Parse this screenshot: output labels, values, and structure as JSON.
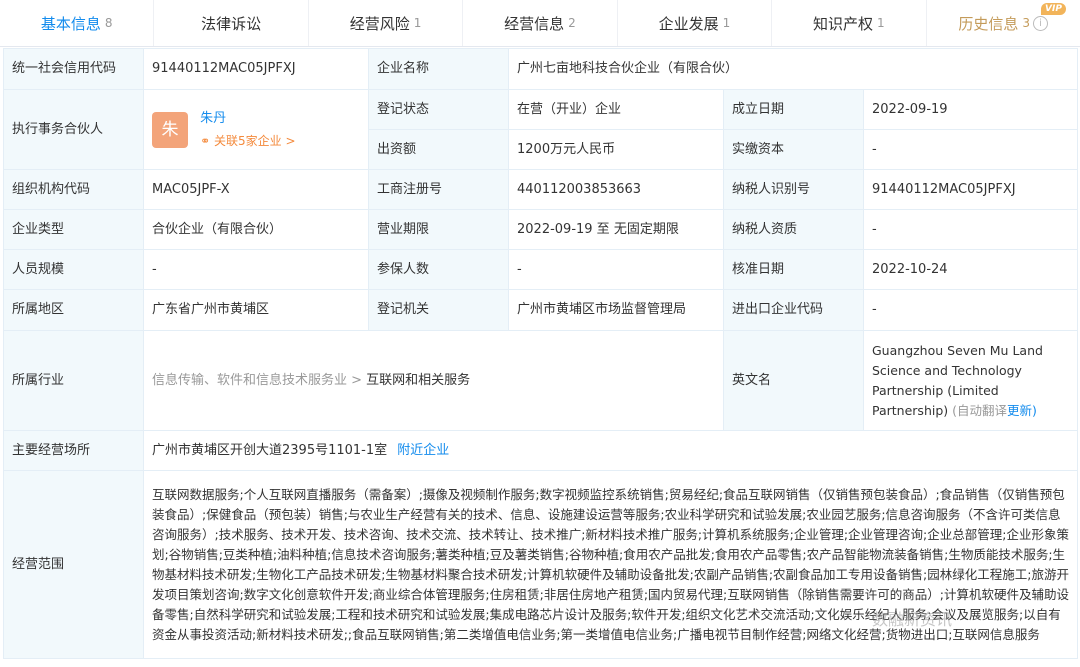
{
  "tabs": [
    {
      "label": "基本信息",
      "count": "8"
    },
    {
      "label": "法律诉讼",
      "count": ""
    },
    {
      "label": "经营风险",
      "count": "1"
    },
    {
      "label": "经营信息",
      "count": "2"
    },
    {
      "label": "企业发展",
      "count": "1"
    },
    {
      "label": "知识产权",
      "count": "1"
    },
    {
      "label": "历史信息",
      "count": "3",
      "badge": "VIP",
      "info_icon": "i"
    }
  ],
  "info": {
    "credit_code_label": "统一社会信用代码",
    "credit_code": "91440112MAC05JPFXJ",
    "company_name_label": "企业名称",
    "company_name": "广州七亩地科技合伙企业（有限合伙）",
    "partner_label": "执行事务合伙人",
    "partner_avatar": "朱",
    "partner_name": "朱丹",
    "partner_related": "关联5家企业 >",
    "status_label": "登记状态",
    "status": "在营（开业）企业",
    "founded_label": "成立日期",
    "founded": "2022-09-19",
    "capital_label": "出资额",
    "capital": "1200万元人民币",
    "paid_label": "实缴资本",
    "paid": "-",
    "org_code_label": "组织机构代码",
    "org_code": "MAC05JPF-X",
    "reg_no_label": "工商注册号",
    "reg_no": "440112003853663",
    "taxpayer_id_label": "纳税人识别号",
    "taxpayer_id": "91440112MAC05JPFXJ",
    "type_label": "企业类型",
    "type": "合伙企业（有限合伙）",
    "term_label": "营业期限",
    "term": "2022-09-19 至 无固定期限",
    "tax_qual_label": "纳税人资质",
    "tax_qual": "-",
    "staff_label": "人员规模",
    "staff": "-",
    "insured_label": "参保人数",
    "insured": "-",
    "approval_label": "核准日期",
    "approval": "2022-10-24",
    "region_label": "所属地区",
    "region": "广东省广州市黄埔区",
    "authority_label": "登记机关",
    "authority": "广州市黄埔区市场监督管理局",
    "import_label": "进出口企业代码",
    "import_code": "-",
    "industry_label": "所属行业",
    "industry_parent": "信息传输、软件和信息技术服务业 >",
    "industry_child": "互联网和相关服务",
    "english_label": "英文名",
    "english": "Guangzhou Seven Mu Land Science and Technology Partnership (Limited Partnership)",
    "english_auto": "(自动翻译",
    "english_update": "更新)",
    "address_label": "主要经营场所",
    "address": "广州市黄埔区开创大道2395号1101-1室",
    "nearby": "附近企业",
    "scope_label": "经营范围",
    "scope": "互联网数据服务;个人互联网直播服务（需备案）;摄像及视频制作服务;数字视频监控系统销售;贸易经纪;食品互联网销售（仅销售预包装食品）;食品销售（仅销售预包装食品）;保健食品（预包装）销售;与农业生产经营有关的技术、信息、设施建设运营等服务;农业科学研究和试验发展;农业园艺服务;信息咨询服务（不含许可类信息咨询服务）;技术服务、技术开发、技术咨询、技术交流、技术转让、技术推广;新材料技术推广服务;计算机系统服务;企业管理;企业管理咨询;企业总部管理;企业形象策划;谷物销售;豆类种植;油料种植;信息技术咨询服务;薯类种植;豆及薯类销售;谷物种植;食用农产品批发;食用农产品零售;农产品智能物流装备销售;生物质能技术服务;生物基材料技术研发;生物化工产品技术研发;生物基材料聚合技术研发;计算机软硬件及辅助设备批发;农副产品销售;农副食品加工专用设备销售;园林绿化工程施工;旅游开发项目策划咨询;数字文化创意软件开发;商业综合体管理服务;住房租赁;非居住房地产租赁;国内贸易代理;互联网销售（除销售需要许可的商品）;计算机软硬件及辅助设备零售;自然科学研究和试验发展;工程和技术研究和试验发展;集成电路芯片设计及服务;软件开发;组织文化艺术交流活动;文化娱乐经纪人服务;会议及展览服务;以自有资金从事投资活动;新材料技术研发;;食品互联网销售;第二类增值电信业务;第一类增值电信业务;广播电视节目制作经营;网络文化经营;货物进出口;互联网信息服务"
  },
  "watermark": "数融新资讯",
  "colors": {
    "accent": "#128bed",
    "label_bg": "#f2f9fc",
    "border": "#e4eef6",
    "related": "#f48a3c",
    "avatar": "#f3a47a",
    "vip": "#f2b45a"
  }
}
